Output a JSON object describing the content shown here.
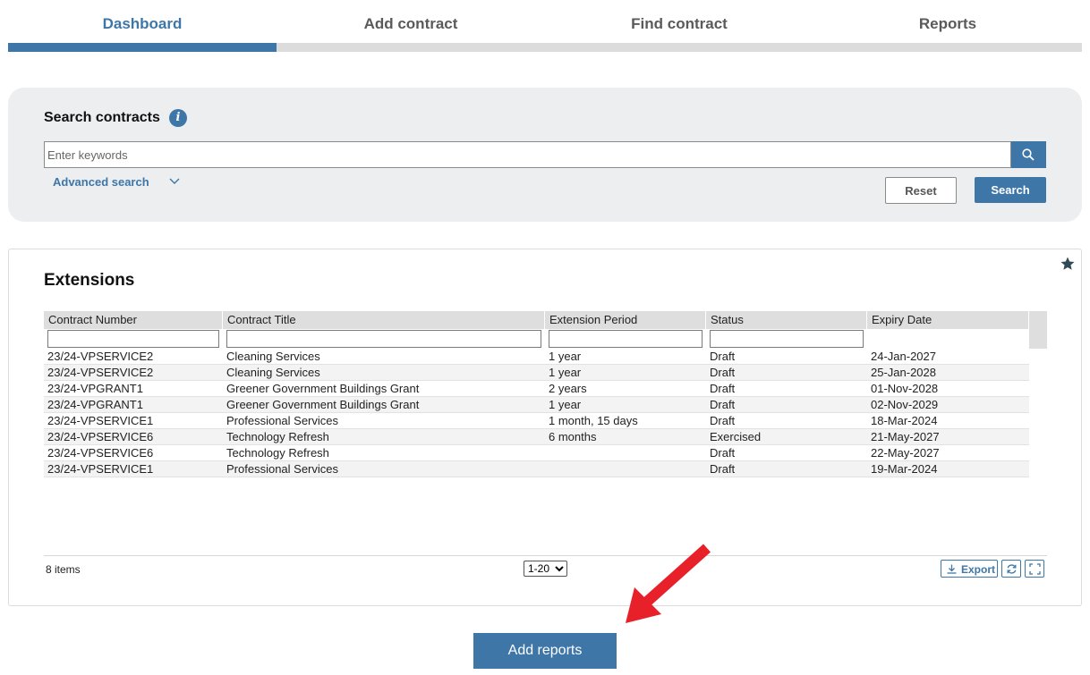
{
  "tabs": [
    {
      "label": "Dashboard",
      "active": true
    },
    {
      "label": "Add contract",
      "active": false
    },
    {
      "label": "Find contract",
      "active": false
    },
    {
      "label": "Reports",
      "active": false
    }
  ],
  "search": {
    "title": "Search contracts",
    "placeholder": "Enter keywords",
    "advanced_label": "Advanced search",
    "reset_label": "Reset",
    "search_label": "Search"
  },
  "extensions": {
    "title": "Extensions",
    "columns": [
      "Contract Number",
      "Contract Title",
      "Extension Period",
      "Status",
      "Expiry Date"
    ],
    "rows": [
      [
        "23/24-VPSERVICE2",
        "Cleaning Services",
        "1 year",
        "Draft",
        "24-Jan-2027"
      ],
      [
        "23/24-VPSERVICE2",
        "Cleaning Services",
        "1 year",
        "Draft",
        "25-Jan-2028"
      ],
      [
        "23/24-VPGRANT1",
        "Greener Government Buildings Grant",
        "2 years",
        "Draft",
        "01-Nov-2028"
      ],
      [
        "23/24-VPGRANT1",
        "Greener Government Buildings Grant",
        "1 year",
        "Draft",
        "02-Nov-2029"
      ],
      [
        "23/24-VPSERVICE1",
        "Professional Services",
        "1 month, 15 days",
        "Draft",
        "18-Mar-2024"
      ],
      [
        "23/24-VPSERVICE6",
        "Technology Refresh",
        "6 months",
        "Exercised",
        "21-May-2027"
      ],
      [
        "23/24-VPSERVICE6",
        "Technology Refresh",
        "",
        "Draft",
        "22-May-2027"
      ],
      [
        "23/24-VPSERVICE1",
        "Professional Services",
        "",
        "Draft",
        "19-Mar-2024"
      ]
    ],
    "items_count": "8 items",
    "page_size": "1-20",
    "export_label": "Export"
  },
  "add_reports_label": "Add reports",
  "colors": {
    "accent": "#3e76a8",
    "arrow": "#e8202a"
  }
}
